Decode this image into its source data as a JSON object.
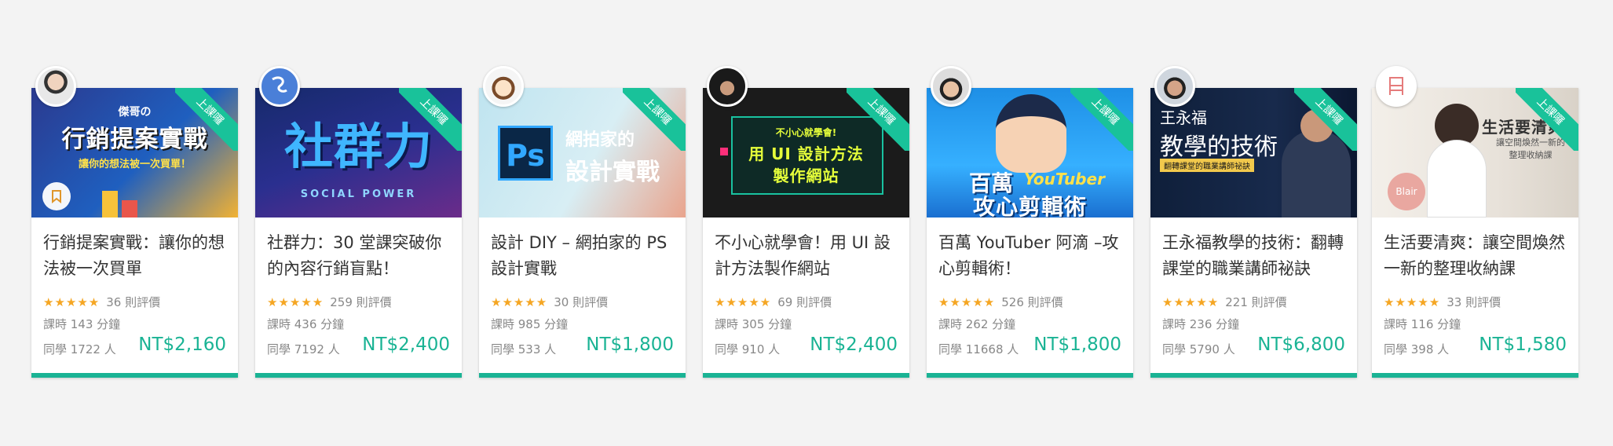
{
  "cards": [
    {
      "ribbon": "上課囉",
      "cover_title": "行銷提案實戰",
      "cover_sub": "讓你的想法被一次買單！",
      "cover_top": "傑哥の",
      "title": "行銷提案實戰：讓你的想法被一次買單",
      "stars": "★★★★★",
      "reviews": "36 則評價",
      "duration": "課時 143 分鐘",
      "students": "同學 1722 人",
      "price": "NT$2,160"
    },
    {
      "ribbon": "上課囉",
      "cover_title": "社群力",
      "cover_sub": "SOCIAL POWER",
      "cover_top": "",
      "title": "社群力：30 堂課突破你的內容行銷盲點！",
      "stars": "★★★★★",
      "reviews": "259 則評價",
      "duration": "課時 436 分鐘",
      "students": "同學 7192 人",
      "price": "NT$2,400"
    },
    {
      "ribbon": "上課囉",
      "cover_title": "設計實戰",
      "cover_sub": "網拍家的",
      "cover_top": "Ps",
      "title": "設計 DIY – 網拍家的 PS 設計實戰",
      "stars": "★★★★★",
      "reviews": "30 則評價",
      "duration": "課時 985 分鐘",
      "students": "同學 533 人",
      "price": "NT$1,800"
    },
    {
      "ribbon": "上課囉",
      "cover_title": "用 UI 設計方法",
      "cover_sub": "製作網站",
      "cover_top": "不小心就學會!",
      "title": "不小心就學會！用 UI 設計方法製作網站",
      "stars": "★★★★★",
      "reviews": "69 則評價",
      "duration": "課時 305 分鐘",
      "students": "同學 910 人",
      "price": "NT$2,400"
    },
    {
      "ribbon": "上課囉",
      "cover_title": "攻心剪輯術",
      "cover_sub": "YouTuber",
      "cover_top": "百萬",
      "title": "百萬 YouTuber 阿滴 –攻心剪輯術！",
      "stars": "★★★★★",
      "reviews": "526 則評價",
      "duration": "課時 262 分鐘",
      "students": "同學 11668 人",
      "price": "NT$1,800"
    },
    {
      "ribbon": "上課囉",
      "cover_title": "教學的技術",
      "cover_sub": "翻轉課堂的職業講師祕訣",
      "cover_top": "王永福",
      "title": "王永福教學的技術：翻轉課堂的職業講師祕訣",
      "stars": "★★★★★",
      "reviews": "221 則評價",
      "duration": "課時 236 分鐘",
      "students": "同學 5790 人",
      "price": "NT$6,800"
    },
    {
      "ribbon": "上課囉",
      "cover_title": "生活要清爽",
      "cover_sub": "讓空間煥然一新的整理收納課",
      "cover_top": "Blair",
      "title": "生活要清爽：讓空間煥然一新的整理收納課",
      "stars": "★★★★★",
      "reviews": "33 則評價",
      "duration": "課時 116 分鐘",
      "students": "同學 398 人",
      "price": "NT$1,580"
    }
  ]
}
